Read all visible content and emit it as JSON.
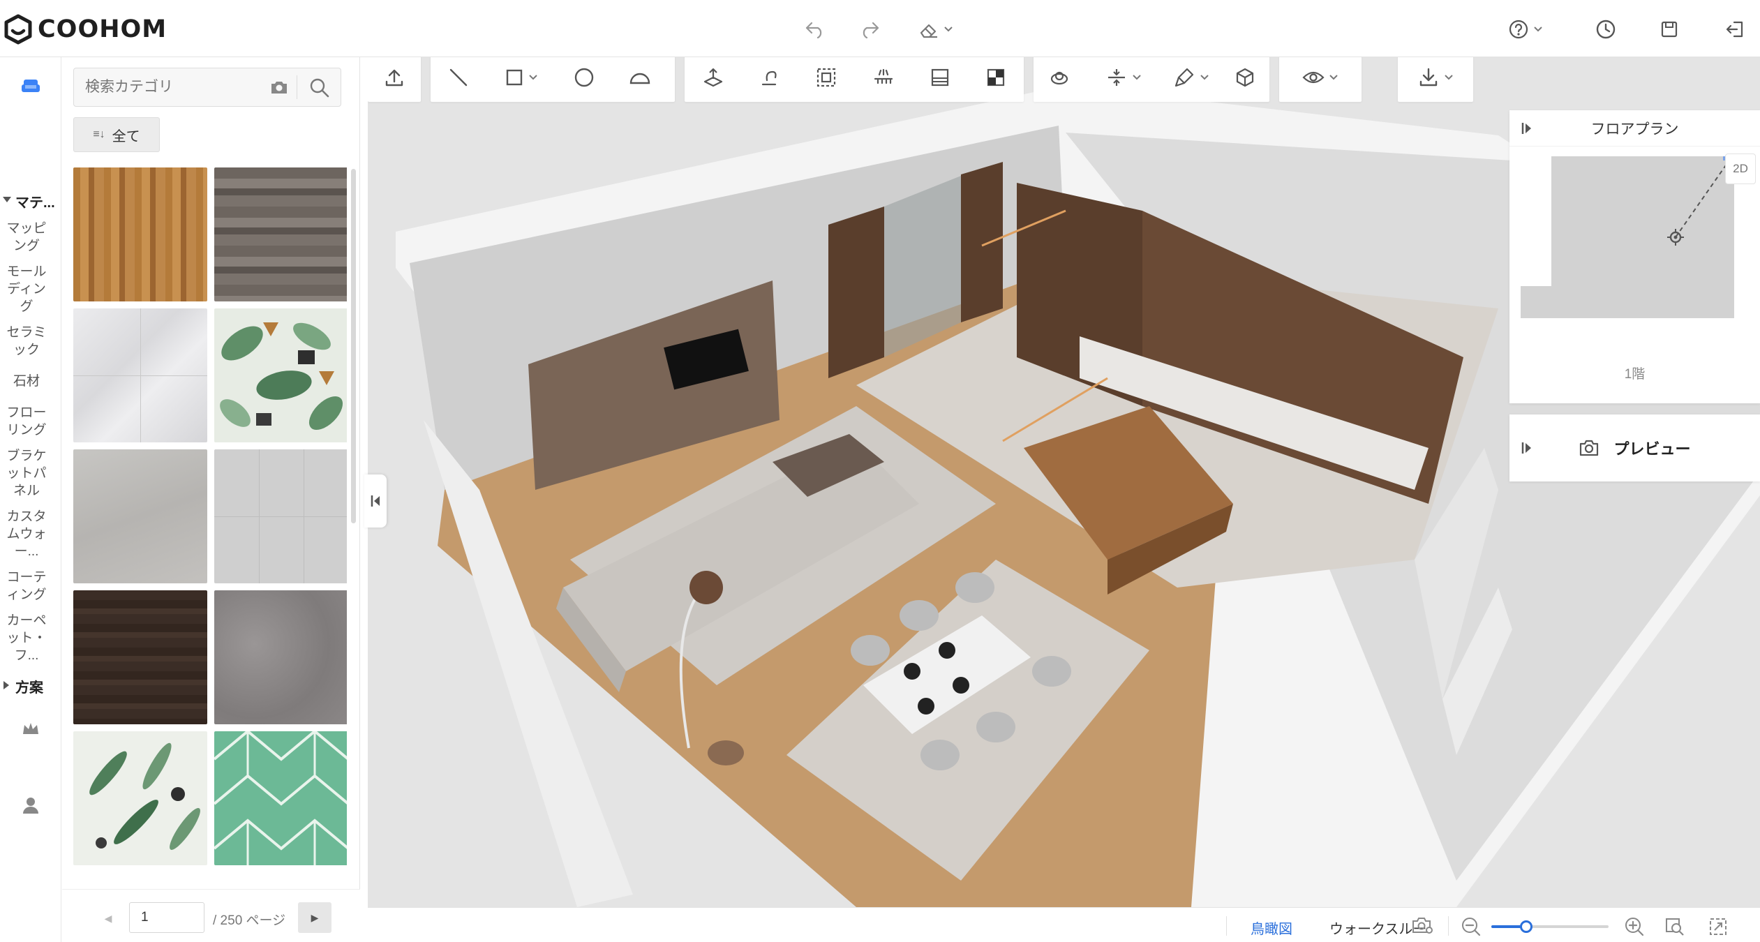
{
  "app": {
    "brand": "COOHOM"
  },
  "colors": {
    "accent": "#2a6fdb",
    "rail_active": "#3b82f6",
    "viewport_bg": "#e4e4e4",
    "wood_floor": "#c49a6c"
  },
  "topbar": {
    "icons": [
      "undo-icon",
      "redo-icon",
      "eraser-icon",
      "help-icon",
      "history-icon",
      "save-icon",
      "exit-icon"
    ]
  },
  "search": {
    "placeholder": "検索カテゴリ"
  },
  "filter": {
    "all_label": "全て"
  },
  "categories": {
    "section_material": "マテ...",
    "items": [
      "マッピング",
      "モールディング",
      "セラミック",
      "石材",
      "フローリング",
      "ブラケットパネル",
      "カスタムウォー...",
      "コーティング",
      "カーペット・フ..."
    ],
    "section_plan": "方案"
  },
  "materials": [
    {
      "name": "wood-oak",
      "color": "#b07a3e"
    },
    {
      "name": "wood-gray",
      "color": "#6e6660"
    },
    {
      "name": "marble-white",
      "color": "#e2e2e4"
    },
    {
      "name": "tropical-leaves",
      "color": "#dfe6dc"
    },
    {
      "name": "stone-gray",
      "color": "#bdbcba"
    },
    {
      "name": "tile-gray",
      "color": "#cfcfcf"
    },
    {
      "name": "wood-dark",
      "color": "#3a2c25"
    },
    {
      "name": "concrete-gray",
      "color": "#8a8686"
    },
    {
      "name": "fern-leaves",
      "color": "#e8ece4"
    },
    {
      "name": "green-geometric",
      "color": "#6cb996"
    }
  ],
  "pagination": {
    "current": "1",
    "total_label": "/ 250 ページ"
  },
  "floorplan": {
    "title": "フロアプラン",
    "floor_label": "1階",
    "view_badge": "2D"
  },
  "preview": {
    "title": "プレビュー"
  },
  "viewmodes": {
    "aerial": "鳥瞰図",
    "walkthrough": "ウォークスルー"
  },
  "zoom": {
    "level": 0.3
  }
}
